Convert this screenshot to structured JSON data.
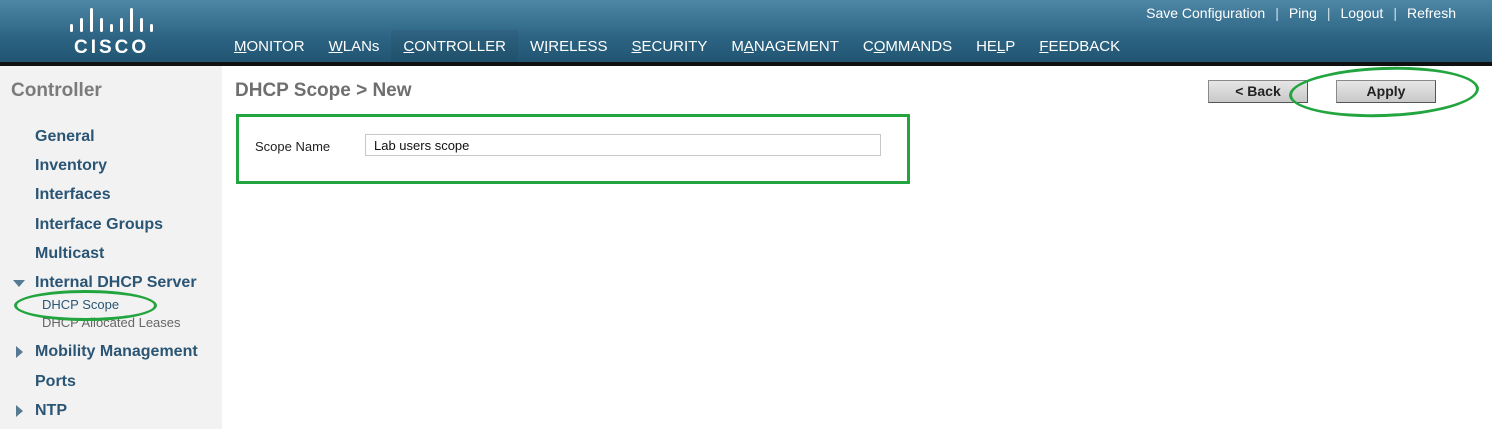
{
  "header": {
    "logo_text": "CISCO",
    "top_links": [
      "Save Configuration",
      "Ping",
      "Logout",
      "Refresh"
    ],
    "separator": "|",
    "nav": [
      {
        "pre": "",
        "u": "M",
        "post": "ONITOR"
      },
      {
        "pre": "",
        "u": "W",
        "post": "LANs"
      },
      {
        "pre": "",
        "u": "C",
        "post": "ONTROLLER"
      },
      {
        "pre": "W",
        "u": "I",
        "post": "RELESS"
      },
      {
        "pre": "",
        "u": "S",
        "post": "ECURITY"
      },
      {
        "pre": "M",
        "u": "A",
        "post": "NAGEMENT"
      },
      {
        "pre": "C",
        "u": "O",
        "post": "MMANDS"
      },
      {
        "pre": "HE",
        "u": "L",
        "post": "P"
      },
      {
        "pre": "",
        "u": "F",
        "post": "EEDBACK"
      }
    ],
    "active_nav": "CONTROLLER"
  },
  "sidebar": {
    "title": "Controller",
    "items": [
      "General",
      "Inventory",
      "Interfaces",
      "Interface Groups",
      "Multicast",
      "Internal DHCP Server",
      "Mobility Management",
      "Ports",
      "NTP"
    ],
    "sub_items": [
      "DHCP Scope",
      "DHCP Allocated Leases"
    ]
  },
  "main": {
    "title": "DHCP Scope > New",
    "back_label": "< Back",
    "apply_label": "Apply",
    "scope_name_label": "Scope Name",
    "scope_name_value": "Lab users scope"
  },
  "colors": {
    "header": "#2d6483",
    "active_tab": "#f0901e",
    "highlight": "#22a53e",
    "sidebar_link": "#2a5574"
  }
}
